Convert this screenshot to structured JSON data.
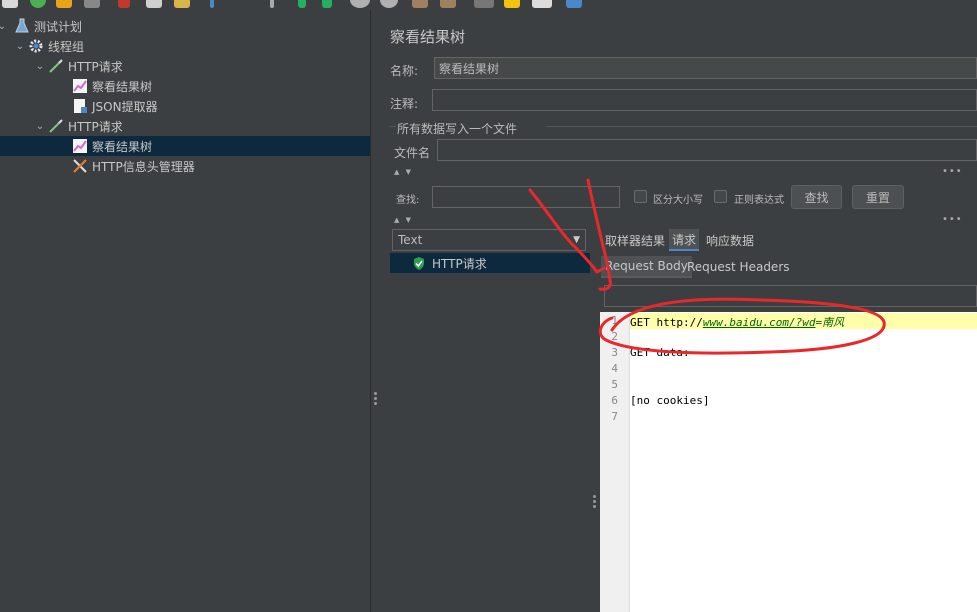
{
  "tree": {
    "items": [
      {
        "label": "测试计划",
        "icon": "flask-icon"
      },
      {
        "label": "线程组",
        "icon": "gear-icon"
      },
      {
        "label": "HTTP请求",
        "icon": "pipette-icon"
      },
      {
        "label": "察看结果树",
        "icon": "chart-icon"
      },
      {
        "label": "JSON提取器",
        "icon": "document-icon"
      },
      {
        "label": "HTTP请求",
        "icon": "pipette-icon"
      },
      {
        "label": "察看结果树",
        "icon": "chart-icon"
      },
      {
        "label": "HTTP信息头管理器",
        "icon": "tools-icon"
      }
    ]
  },
  "panel": {
    "title": "察看结果树",
    "name_label": "名称:",
    "name_value": "察看结果树",
    "comment_label": "注释:",
    "comment_value": "",
    "file_group_label": "所有数据写入一个文件",
    "filename_label": "文件名",
    "filename_value": ""
  },
  "search": {
    "label": "查找:",
    "value": "",
    "case_label": "区分大小写",
    "regex_label": "正则表达式",
    "find_button": "查找",
    "reset_button": "重置"
  },
  "results": {
    "renderer": "Text",
    "items": [
      {
        "label": "HTTP请求",
        "status": "success"
      }
    ]
  },
  "tabs": {
    "items": [
      "取样器结果",
      "请求",
      "响应数据"
    ],
    "active": "请求"
  },
  "subtabs": {
    "items": [
      "Request Body",
      "Request Headers"
    ],
    "active": "Request Body"
  },
  "editor": {
    "line_numbers": [
      "1",
      "2",
      "3",
      "4",
      "5",
      "6",
      "7"
    ],
    "line1_method": "GET http://",
    "line1_url": "www.baidu.com/?wd",
    "line1_tail": "=南风",
    "line3": "GET data:",
    "line6": "[no cookies]"
  },
  "colors": {
    "selection": "#0d293e",
    "annotation": "#e8282b",
    "highlight_line": "#ffffaa"
  }
}
